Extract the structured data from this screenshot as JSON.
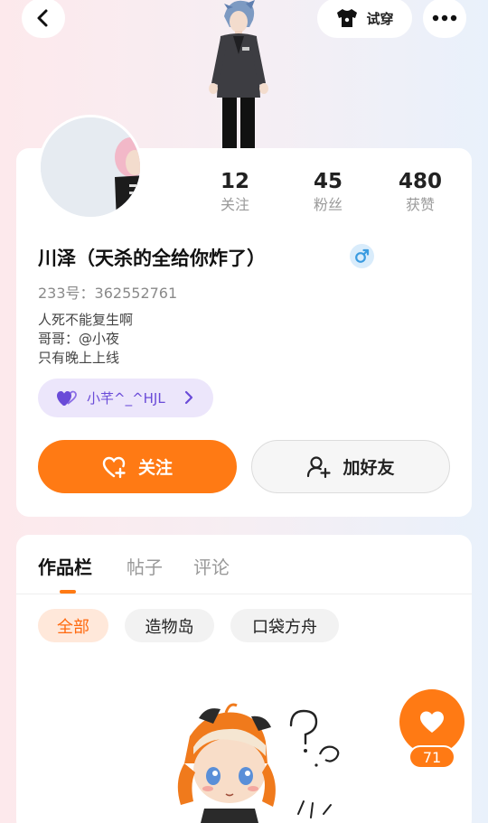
{
  "header": {
    "try_on_label": "试穿"
  },
  "profile": {
    "name": "川泽（天杀的全给你炸了）",
    "uid": "233号：362552761",
    "bio_lines": [
      "人死不能复生啊",
      "哥哥：@小夜",
      "只有晚上上线"
    ],
    "gender": "male",
    "stats": [
      {
        "value": "12",
        "label": "关注"
      },
      {
        "value": "45",
        "label": "粉丝"
      },
      {
        "value": "480",
        "label": "获赞"
      }
    ],
    "tag_label": "小芊^_^HJL",
    "follow_label": "关注",
    "add_friend_label": "加好友"
  },
  "works": {
    "tabs": [
      {
        "label": "作品栏",
        "active": true
      },
      {
        "label": "帖子",
        "active": false
      },
      {
        "label": "评论",
        "active": false
      }
    ],
    "chips": [
      {
        "label": "全部",
        "active": true
      },
      {
        "label": "造物岛",
        "active": false
      },
      {
        "label": "口袋方舟",
        "active": false
      }
    ],
    "like_count": "71"
  },
  "colors": {
    "accent": "#ff7a14",
    "tag_purple": "#6a4bd8",
    "gender_blue": "#3a9be0"
  }
}
